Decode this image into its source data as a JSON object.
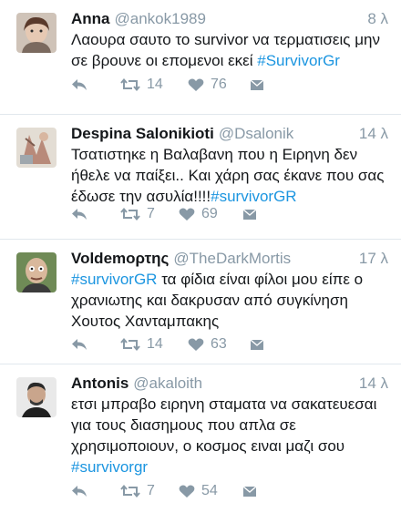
{
  "colors": {
    "link": "#1b95e0",
    "meta": "#8899a6",
    "text": "#14171a",
    "divider": "#e1e8ed"
  },
  "tweets": [
    {
      "name": "Anna",
      "handle": "@ankok1989",
      "time": "8 λ",
      "lines": [
        {
          "text": "Λαουρα σαυτο το survivor να τερματισεις μην"
        },
        {
          "text": "σε βρουνε οι επομενοι εκεί ",
          "tag": "#SurvivorGr"
        }
      ],
      "retweets": "14",
      "likes": "76",
      "avatar_icon": "avatar-photo-woman"
    },
    {
      "name": "Despina Salonikioti",
      "handle": "@Dsalonik",
      "time": "14 λ",
      "lines": [
        {
          "text": "Τσατιστηκε η Βαλαβανη που η Ειρηνη δεν"
        },
        {
          "text": "ήθελε να παίξει.. Και χάρη σας έκανε που σας"
        },
        {
          "text": "έδωσε την ασυλία!!!!",
          "tag": "#survivorGR"
        }
      ],
      "retweets": "7",
      "likes": "69",
      "avatar_icon": "avatar-photo-art"
    },
    {
      "name": "Voldemορτης",
      "handle": "@TheDarkMortis",
      "time": "17 λ",
      "lines": [
        {
          "lead_tag": "#survivorGR",
          "text": " τα φίδια είναι φίλοι μου είπε ο"
        },
        {
          "text": "χρανιωτης και δακρυσαν από συγκίνηση"
        },
        {
          "text": "Χουτος Χανταμπακης"
        }
      ],
      "retweets": "14",
      "likes": "63",
      "avatar_icon": "avatar-photo-man-bald"
    },
    {
      "name": "Antonis",
      "handle": "@akaloith",
      "time": "14 λ",
      "lines": [
        {
          "text": "ετσι μπραβο ειρηνη σταματα να σακατευεσαι"
        },
        {
          "text": "για τους διασημους που απλα σε"
        },
        {
          "text": "χρησιμοποιουν, ο κοσμος ειναι μαζι σου"
        },
        {
          "tag": "#survivorgr"
        }
      ],
      "retweets": "7",
      "likes": "54",
      "avatar_icon": "avatar-photo-man"
    }
  ]
}
